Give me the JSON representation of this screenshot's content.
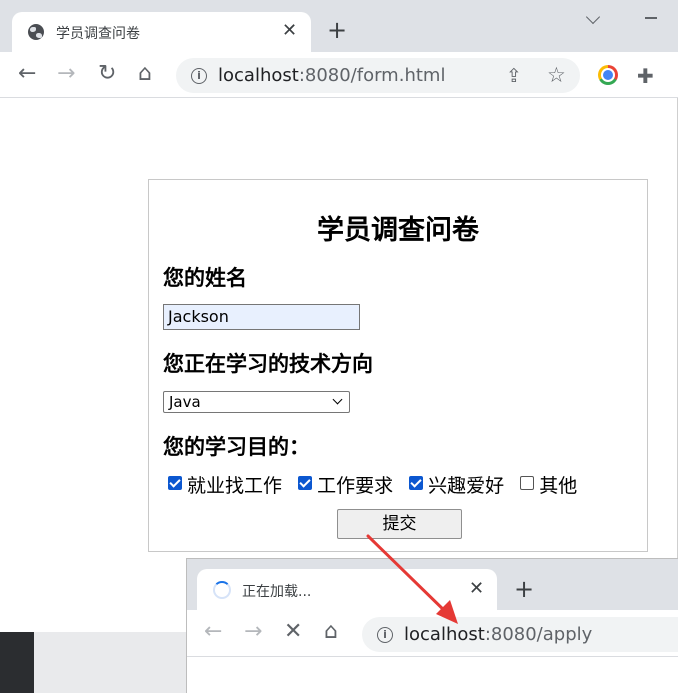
{
  "main_window": {
    "tab": {
      "title": "学员调查问卷",
      "close": "✕"
    },
    "new_tab": "+",
    "nav": {
      "back": "←",
      "forward": "→",
      "reload": "↻",
      "home": "⌂"
    },
    "omnibox": {
      "host": "localhost",
      "rest": ":8080/form.html"
    }
  },
  "form": {
    "title": "学员调查问卷",
    "name_label": "您的姓名",
    "name_value": "Jackson",
    "direction_label": "您正在学习的技术方向",
    "direction_selected": "Java",
    "purpose_label": "您的学习目的：",
    "purposes": [
      {
        "label": "就业找工作",
        "checked": true
      },
      {
        "label": "工作要求",
        "checked": true
      },
      {
        "label": "兴趣爱好",
        "checked": true
      },
      {
        "label": "其他",
        "checked": false
      }
    ],
    "submit_label": "提交"
  },
  "annotation": {
    "arrow_color": "#e53935"
  },
  "second_window": {
    "tab": {
      "title": "正在加载...",
      "close": "✕"
    },
    "new_tab": "+",
    "nav": {
      "back": "←",
      "forward": "→",
      "stop": "✕",
      "home": "⌂"
    },
    "omnibox": {
      "host": "localhost",
      "rest": ":8080/apply"
    }
  }
}
